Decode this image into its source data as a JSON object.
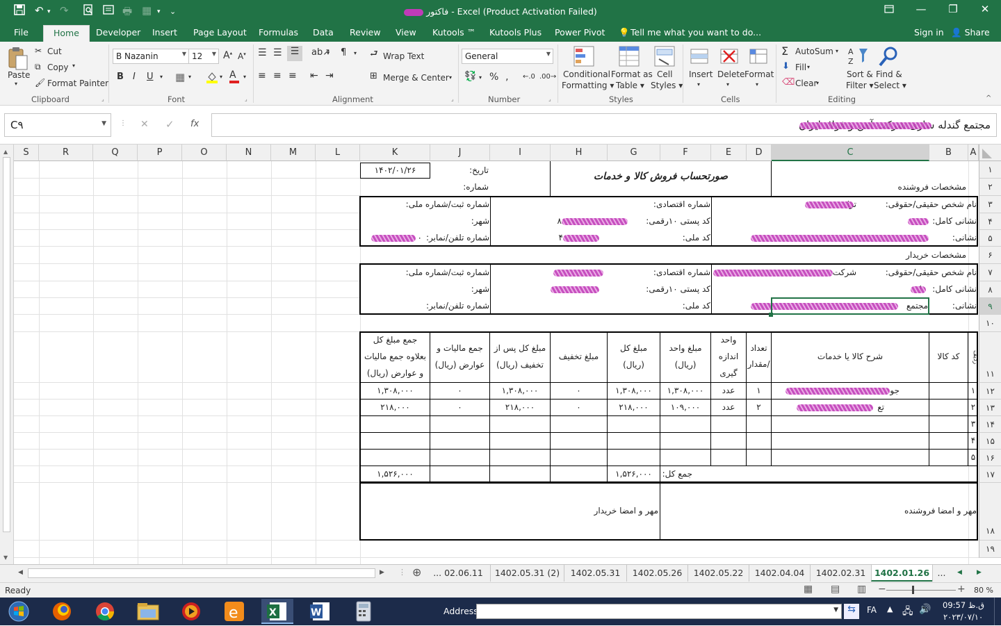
{
  "window": {
    "title_prefix": "فاکتور",
    "title": " - Excel (Product Activation Failed)",
    "restore_glyph": "🗗",
    "min_glyph": "—",
    "max_glyph": "❐",
    "close_glyph": "✕"
  },
  "tabs": [
    "File",
    "Home",
    "Developer",
    "Insert",
    "Page Layout",
    "Formulas",
    "Data",
    "Review",
    "View",
    "Kutools ™",
    "Kutools Plus",
    "Power Pivot"
  ],
  "tell_me": "Tell me what you want to do...",
  "sign_in": "Sign in",
  "share": "Share",
  "ribbon": {
    "paste": "Paste",
    "cut": "Cut",
    "copy": "Copy",
    "format_painter": "Format Painter",
    "font_name": "B Nazanin",
    "font_size": "12",
    "number_format": "General",
    "wrap_text": "Wrap Text",
    "merge_center": "Merge & Center",
    "conditional_formatting": [
      "Conditional",
      "Formatting ▾"
    ],
    "format_as_table": [
      "Format as",
      "Table ▾"
    ],
    "cell_styles": [
      "Cell",
      "Styles ▾"
    ],
    "insert": "Insert",
    "delete": "Delete",
    "format": "Format",
    "autosum": "AutoSum",
    "fill": "Fill",
    "clear": "Clear",
    "sort_filter": [
      "Sort &",
      "Filter ▾"
    ],
    "find_select": [
      "Find &",
      "Select ▾"
    ],
    "groups": {
      "clipboard": "Clipboard",
      "font": "Font",
      "alignment": "Alignment",
      "number": "Number",
      "styles": "Styles",
      "cells": "Cells",
      "editing": "Editing"
    }
  },
  "formula_bar": {
    "name_box": "C۹",
    "formula": "مجتمع گندله سازی شرکت آهن و فولاد ایران",
    "fx": "fx"
  },
  "columns": [
    "S",
    "R",
    "Q",
    "P",
    "O",
    "N",
    "M",
    "L",
    "K",
    "J",
    "I",
    "H",
    "G",
    "F",
    "E",
    "D",
    "C",
    "B",
    "A"
  ],
  "rows": [
    "۱",
    "۲",
    "۳",
    "۴",
    "۵",
    "۶",
    "۷",
    "۸",
    "۹",
    "۱۰",
    "۱۱",
    "۱۲",
    "۱۳",
    "۱۴",
    "۱۵",
    "۱۶",
    "۱۷",
    "۱۸",
    "۱۹"
  ],
  "invoice": {
    "title": "صورتحساب فروش کالا و خدمات",
    "date_label": "تاریخ:",
    "date_value": "۱۴۰۲/۰۱/۲۶",
    "number_label": "شماره:",
    "seller_header": "مشخصات فروشنده",
    "buyer_header": "مشخصات خریدار",
    "person_label": "نام شخص حقیقی/حقوقی:",
    "full_address_label": "نشانی کامل:",
    "address_label": "نشانی:",
    "economic_no": "شماره اقتصادی:",
    "postal_code": "کد پستی ۱۰رقمی:",
    "national_code": "کد ملی:",
    "reg_no": "شماره ثبت/شماره ملی:",
    "city": "شهر:",
    "phone": "شماره تلفن/نمابر:",
    "seller_name_partial": "ترا",
    "seller_postal_partial": "۸",
    "seller_national_partial": "۴",
    "seller_phone_partial": "۰",
    "buyer_name_partial": "شرکت",
    "buyer_city_partial": "ا",
    "buyer_address_partial": "مجتمع",
    "table_headers": {
      "row": "ردیف",
      "code": "کد کالا",
      "description": "شرح کالا یا خدمات",
      "qty": [
        "تعداد",
        "/مقدار"
      ],
      "unit": [
        "واحد",
        "اندازه",
        "گیری"
      ],
      "unit_price": [
        "مبلغ واحد",
        "(ریال)"
      ],
      "total": [
        "مبلغ کل",
        "(ریال)"
      ],
      "discount": "مبلغ تخفیف",
      "after_discount": [
        "مبلغ کل پس از",
        "تخفیف (ریال)"
      ],
      "tax": [
        "جمع مالیات و",
        "عوارض (ریال)"
      ],
      "grand": [
        "جمع مبلغ کل",
        "بعلاوه جمع مالیات",
        "و عوارض (ریال)"
      ]
    },
    "items": [
      {
        "idx": "۱",
        "desc_partial": "جو",
        "qty": "۱",
        "unit": "عدد",
        "unit_price": "۱,۳۰۸,۰۰۰",
        "total": "۱,۳۰۸,۰۰۰",
        "discount": "۰",
        "after_discount": "۱,۳۰۸,۰۰۰",
        "tax": "۰",
        "grand": "۱,۳۰۸,۰۰۰"
      },
      {
        "idx": "۲",
        "desc_partial": "تع",
        "qty": "۲",
        "unit": "عدد",
        "unit_price": "۱۰۹,۰۰۰",
        "total": "۲۱۸,۰۰۰",
        "discount": "۰",
        "after_discount": "۲۱۸,۰۰۰",
        "tax": "۰",
        "grand": "۲۱۸,۰۰۰"
      },
      {
        "idx": "۳"
      },
      {
        "idx": "۴"
      },
      {
        "idx": "۵"
      }
    ],
    "sum_label": "جمع کل:",
    "sum_total": "۱,۵۲۶,۰۰۰",
    "sum_grand": "۱,۵۲۶,۰۰۰",
    "seller_sign": "مهر و امضا فروشنده",
    "buyer_sign": "مهر و امضا خریدار"
  },
  "sheets": [
    "...",
    "02.06.11",
    "1402.05.31 (2)",
    "1402.05.31",
    "1402.05.26",
    "1402.05.22",
    "1402.04.04",
    "1402.02.31",
    "1402.01.26",
    "..."
  ],
  "status": {
    "ready": "Ready",
    "zoom": "80 %"
  },
  "taskbar": {
    "address_label": "Address",
    "lang": "FA",
    "time": "ق.ظ 09:57",
    "date": "۲۰۲۳/۰۷/۱۰"
  },
  "colors": {
    "excel_green": "#217346",
    "scribble": "#c03bb8"
  }
}
